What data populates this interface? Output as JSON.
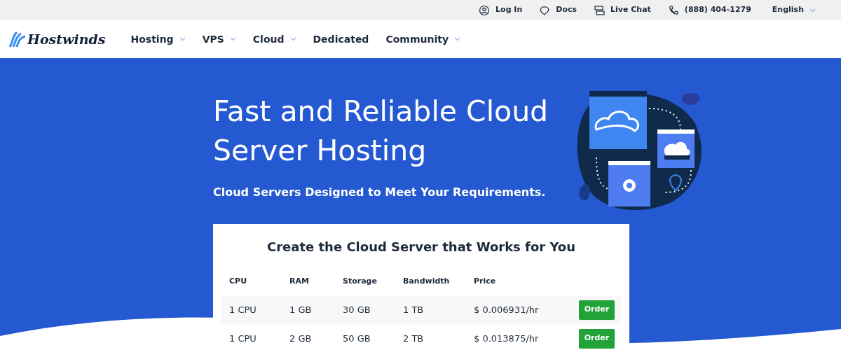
{
  "top_bar": {
    "links": [
      {
        "kind": "user",
        "label": "Log In"
      },
      {
        "kind": "docs",
        "label": "Docs"
      },
      {
        "kind": "chat",
        "label": "Live Chat"
      },
      {
        "kind": "phone",
        "label": "(888) 404-1279"
      }
    ],
    "language": "English"
  },
  "nav": {
    "logo": "Hostwinds",
    "items": [
      {
        "label": "Hosting",
        "dropdown": true
      },
      {
        "label": "VPS",
        "dropdown": true
      },
      {
        "label": "Cloud",
        "dropdown": true
      },
      {
        "label": "Dedicated",
        "dropdown": false
      },
      {
        "label": "Community",
        "dropdown": true
      }
    ]
  },
  "hero": {
    "title": "Fast and Reliable Cloud Server Hosting",
    "subtitle": "Cloud Servers Designed to Meet Your Requirements."
  },
  "plans": {
    "title": "Create the Cloud Server that Works for You",
    "columns": [
      "CPU",
      "RAM",
      "Storage",
      "Bandwidth",
      "Price"
    ],
    "rows": [
      {
        "cells": [
          "1 CPU",
          "1 GB",
          "30 GB",
          "1 TB",
          "$ 0.006931/hr"
        ],
        "button": "Order"
      },
      {
        "cells": [
          "1 CPU",
          "2 GB",
          "50 GB",
          "2 TB",
          "$ 0.013875/hr"
        ],
        "button": "Order"
      }
    ]
  }
}
